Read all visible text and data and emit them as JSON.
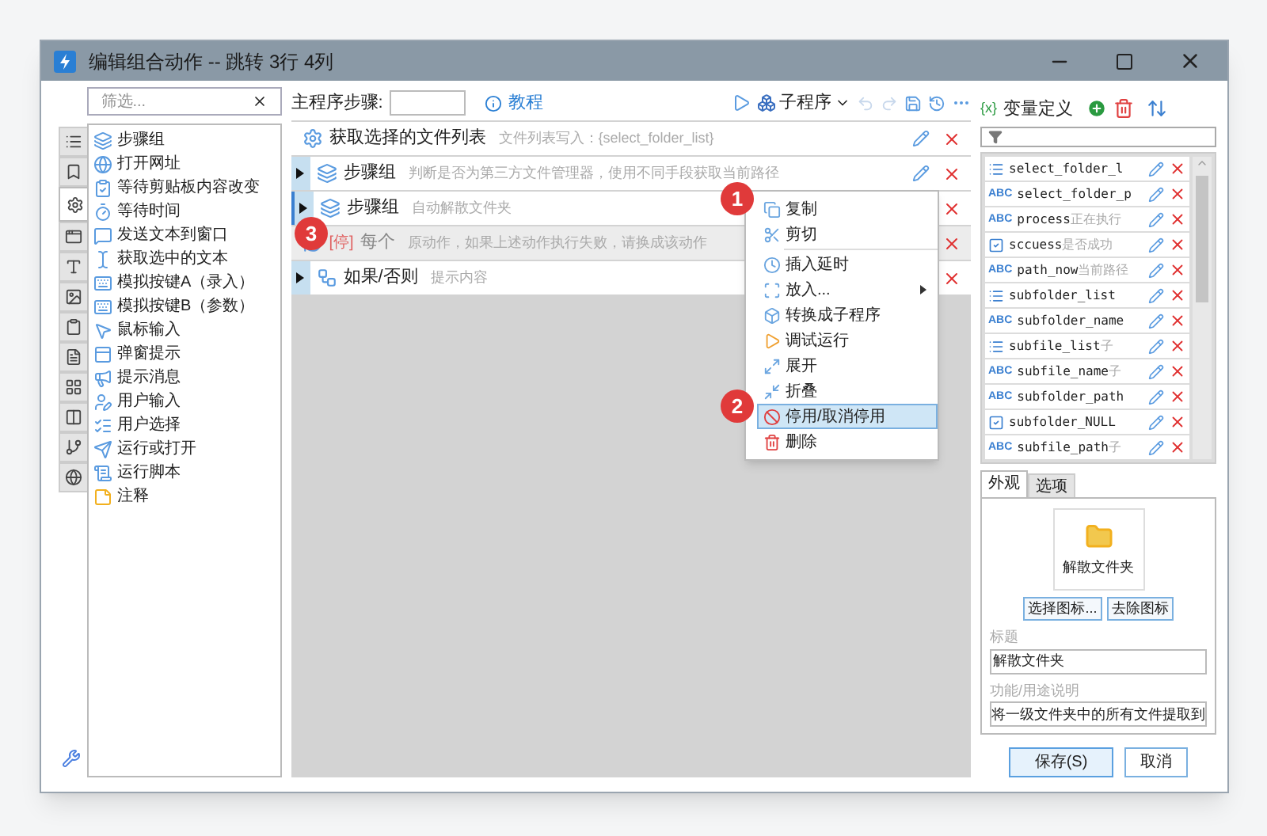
{
  "window": {
    "title": "编辑组合动作 -- 跳转 3行 4列"
  },
  "left_tabs": [
    {
      "selected": false
    },
    {
      "selected": false
    },
    {
      "selected": true
    },
    {
      "selected": false
    },
    {
      "selected": false
    },
    {
      "selected": false
    },
    {
      "selected": false
    },
    {
      "selected": false
    },
    {
      "selected": false
    },
    {
      "selected": false
    },
    {
      "selected": false
    },
    {
      "selected": false
    }
  ],
  "action_list": {
    "filter": {
      "placeholder": "筛选..."
    },
    "items": [
      {
        "label": "步骤组"
      },
      {
        "label": "打开网址"
      },
      {
        "label": "等待剪贴板内容改变"
      },
      {
        "label": "等待时间"
      },
      {
        "label": "发送文本到窗口"
      },
      {
        "label": "获取选中的文本"
      },
      {
        "label": "模拟按键A（录入）"
      },
      {
        "label": "模拟按键B（参数）"
      },
      {
        "label": "鼠标输入"
      },
      {
        "label": "弹窗提示"
      },
      {
        "label": "提示消息"
      },
      {
        "label": "用户输入"
      },
      {
        "label": "用户选择"
      },
      {
        "label": "运行或打开"
      },
      {
        "label": "运行脚本"
      },
      {
        "label": "注释"
      }
    ]
  },
  "toolbar": {
    "steps_label": "主程序步骤:",
    "tutorial": "教程",
    "subprogram": "子程序"
  },
  "steps": [
    {
      "kind": "action",
      "title": "获取选择的文件列表",
      "description": "文件列表写入：{select_folder_list}",
      "expandable": false,
      "selected": false,
      "disabled": false,
      "editable": true
    },
    {
      "kind": "group",
      "title": "步骤组",
      "description": "判断是否为第三方文件管理器，使用不同手段获取当前路径",
      "expandable": true,
      "selected": false,
      "disabled": false,
      "editable": true
    },
    {
      "kind": "group",
      "title": "步骤组",
      "description": "自动解散文件夹",
      "expandable": true,
      "selected": true,
      "disabled": false,
      "editable": false
    },
    {
      "kind": "loop",
      "tag": "[停]",
      "title": "每个",
      "description": "原动作，如果上述动作执行失败，请换成该动作",
      "expandable": false,
      "selected": false,
      "disabled": true,
      "editable": false
    },
    {
      "kind": "condition",
      "title": "如果/否则",
      "description": "提示内容",
      "expandable": true,
      "selected": false,
      "disabled": false,
      "editable": false
    }
  ],
  "context_menu": [
    {
      "kind": "copy",
      "label": "复制",
      "selected": false
    },
    {
      "kind": "cut",
      "label": "剪切",
      "selected": false
    },
    {
      "kind": "separator"
    },
    {
      "kind": "delay",
      "label": "插入延时",
      "selected": false
    },
    {
      "kind": "put",
      "label": "放入...",
      "selected": false,
      "submenu": true
    },
    {
      "kind": "convert",
      "label": "转换成子程序",
      "selected": false
    },
    {
      "kind": "run",
      "label": "调试运行",
      "selected": false
    },
    {
      "kind": "expand",
      "label": "展开",
      "selected": false
    },
    {
      "kind": "collapse",
      "label": "折叠",
      "selected": false
    },
    {
      "kind": "disable",
      "label": "停用/取消停用",
      "selected": true
    },
    {
      "kind": "delete",
      "label": "删除",
      "selected": false
    }
  ],
  "badges": [
    {
      "label": "1"
    },
    {
      "label": "2"
    },
    {
      "label": "3"
    }
  ],
  "variables": {
    "icon_text": "{x}",
    "title": "变量定义",
    "items": [
      {
        "kind": "list",
        "name": "select_folder_l"
      },
      {
        "kind": "text",
        "type_label": "ABC",
        "name": "select_folder_p"
      },
      {
        "kind": "text",
        "type_label": "ABC",
        "name": "process",
        "note": "正在执行"
      },
      {
        "kind": "bool",
        "name": "sccuess",
        "note": "是否成功"
      },
      {
        "kind": "text",
        "type_label": "ABC",
        "name": "path_now",
        "note": "当前路径"
      },
      {
        "kind": "list",
        "name": "subfolder_list"
      },
      {
        "kind": "text",
        "type_label": "ABC",
        "name": "subfolder_name"
      },
      {
        "kind": "list",
        "name": "subfile_list",
        "note": "子"
      },
      {
        "kind": "text",
        "type_label": "ABC",
        "name": "subfile_name",
        "note": "子"
      },
      {
        "kind": "text",
        "type_label": "ABC",
        "name": "subfolder_path"
      },
      {
        "kind": "bool",
        "name": "subfolder_NULL"
      },
      {
        "kind": "text",
        "type_label": "ABC",
        "name": "subfile_path",
        "note": "子"
      }
    ]
  },
  "props_tabs": [
    {
      "label": "外观",
      "selected": true
    },
    {
      "label": "选项",
      "selected": false
    }
  ],
  "appearance": {
    "icon_label": "解散文件夹",
    "choose_icon": "选择图标...",
    "remove_icon": "去除图标",
    "title_label": "标题",
    "title_value": "解散文件夹",
    "desc_label": "功能/用途说明",
    "desc_value": "将一级文件夹中的所有文件提取到"
  },
  "buttons": [
    {
      "label": "保存(S)",
      "kind": "primary"
    },
    {
      "label": "取消",
      "kind": "normal"
    }
  ]
}
